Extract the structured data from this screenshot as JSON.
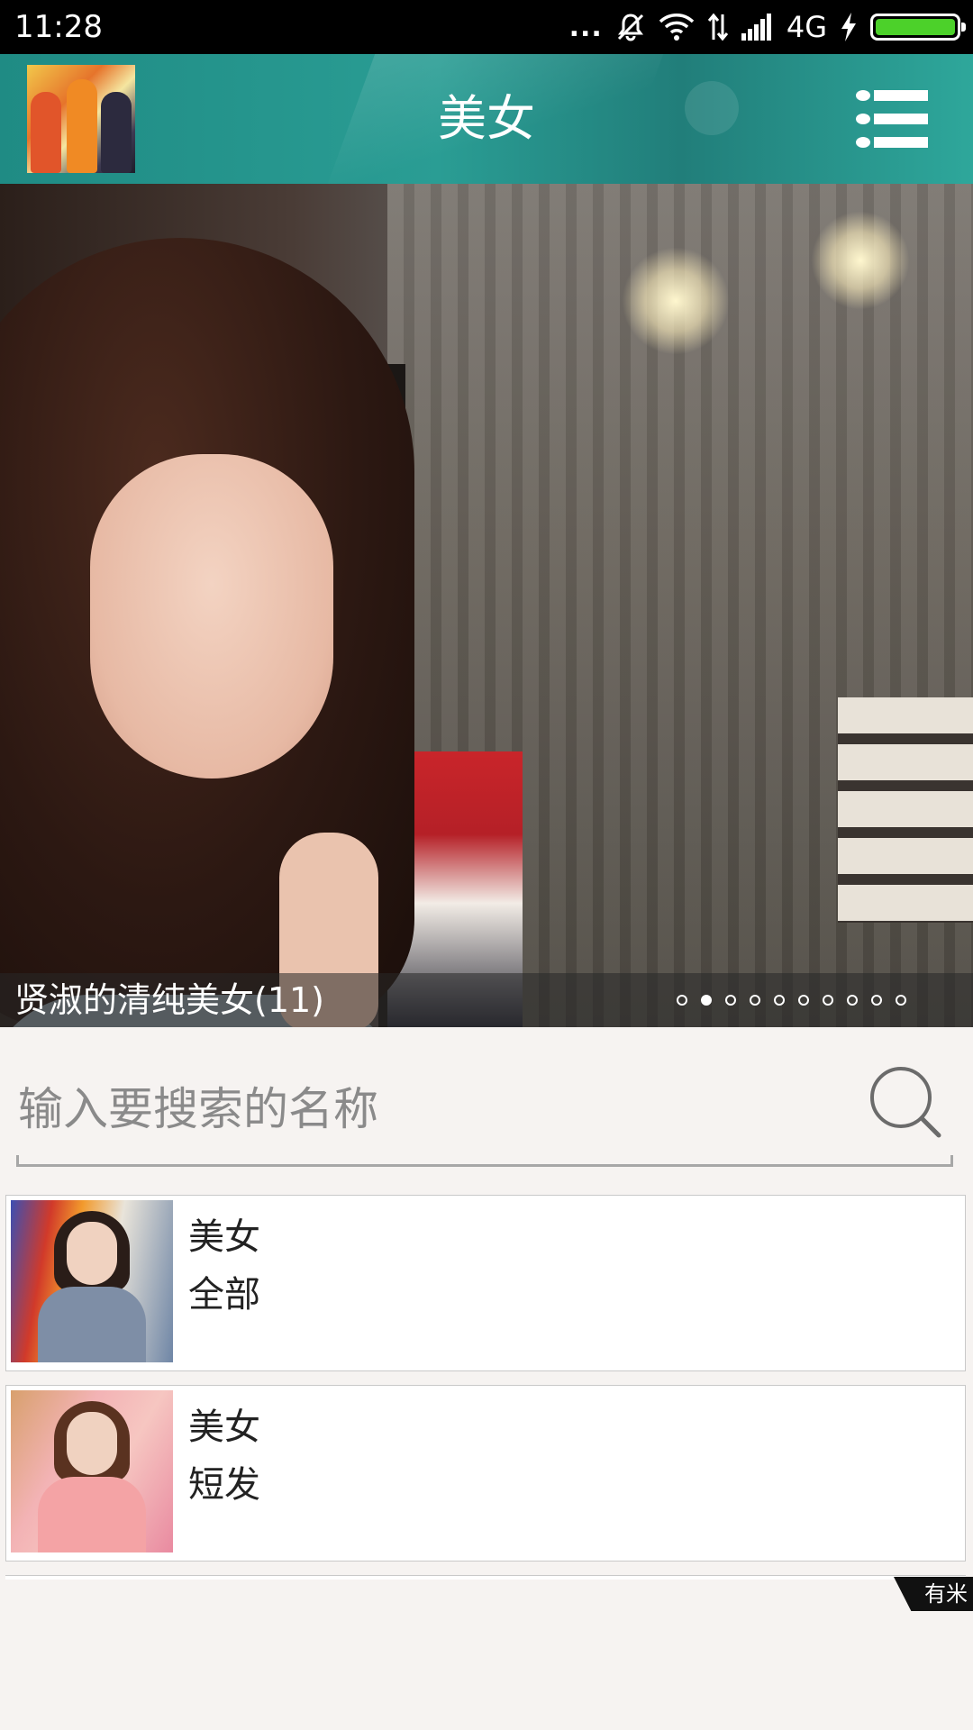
{
  "status_bar": {
    "time": "11:28",
    "more": "...",
    "network": "4G",
    "battery_level": 1.0,
    "battery_color": "#4cd12a",
    "icons": [
      "more-dots-icon",
      "mute-icon",
      "wifi-icon",
      "data-arrows-icon",
      "signal-icon",
      "charging-icon",
      "battery-icon"
    ]
  },
  "header": {
    "title": "美女",
    "background": "#2a9d94",
    "avatar_icon": "app-avatar",
    "menu_icon": "list-menu-icon"
  },
  "banner": {
    "caption": "贤淑的清纯美女(11)",
    "page_count": 10,
    "active_page": 2
  },
  "search": {
    "placeholder": "输入要搜索的名称",
    "value": "",
    "icon": "search-icon"
  },
  "list": {
    "items": [
      {
        "title": "美女",
        "subtitle": "全部"
      },
      {
        "title": "美女",
        "subtitle": "短发"
      }
    ]
  },
  "ad_badge": {
    "label": "有米"
  }
}
